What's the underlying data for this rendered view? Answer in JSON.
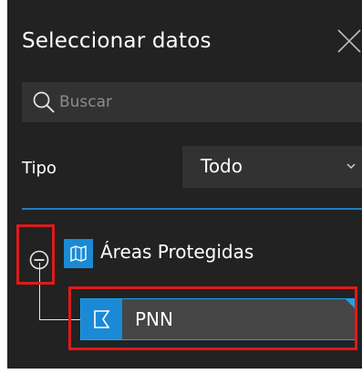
{
  "panel": {
    "title": "Seleccionar datos",
    "close_icon": "close-icon"
  },
  "search": {
    "placeholder": "Buscar",
    "value": "",
    "icon": "search-icon"
  },
  "filter": {
    "label": "Tipo",
    "selected": "Todo",
    "icon": "chevron-down-icon"
  },
  "tree": {
    "group": {
      "label": "Áreas Protegidas",
      "toggle_icon": "collapse-minus-icon",
      "type_icon": "map-icon",
      "expanded": true
    },
    "items": [
      {
        "label": "PNN",
        "type_icon": "polygon-layer-icon",
        "selected": true
      }
    ]
  },
  "colors": {
    "panel_bg": "#222222",
    "field_bg": "#323232",
    "accent": "#1a8ad6",
    "selection_border": "#1fa1e8",
    "annotation": "#e01a1a"
  }
}
